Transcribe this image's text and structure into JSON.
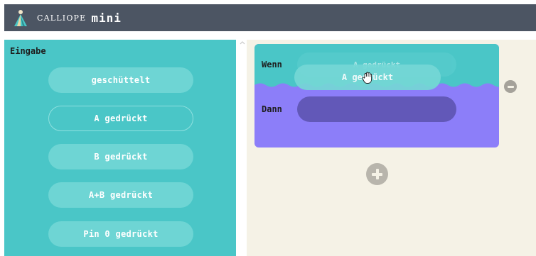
{
  "header": {
    "brand_name": "CALLIOPE",
    "brand_suffix": "mini",
    "logo_icon": "calliope-figure-icon",
    "background": "#4c5563"
  },
  "sidebar": {
    "title": "Eingabe",
    "background": "#4ac6c7",
    "blocks": [
      {
        "label": "geschüttelt",
        "style": "filled"
      },
      {
        "label": "A gedrückt",
        "style": "outline"
      },
      {
        "label": "B gedrückt",
        "style": "filled"
      },
      {
        "label": "A+B gedrückt",
        "style": "filled"
      },
      {
        "label": "Pin 0 gedrückt",
        "style": "filled"
      }
    ]
  },
  "workspace": {
    "background": "#f5f2e6",
    "rule": {
      "when_label": "Wenn",
      "then_label": "Dann",
      "when_slot_label": "A gedrückt",
      "dragged_block_label": "A gedrückt",
      "when_color": "#4ac6c7",
      "then_color": "#8c7ef9",
      "then_slot_color": "#6258b8"
    },
    "remove_icon": "minus-circle-icon",
    "add_icon": "plus-circle-icon",
    "cursor_icon": "grab-hand-cursor-icon"
  }
}
